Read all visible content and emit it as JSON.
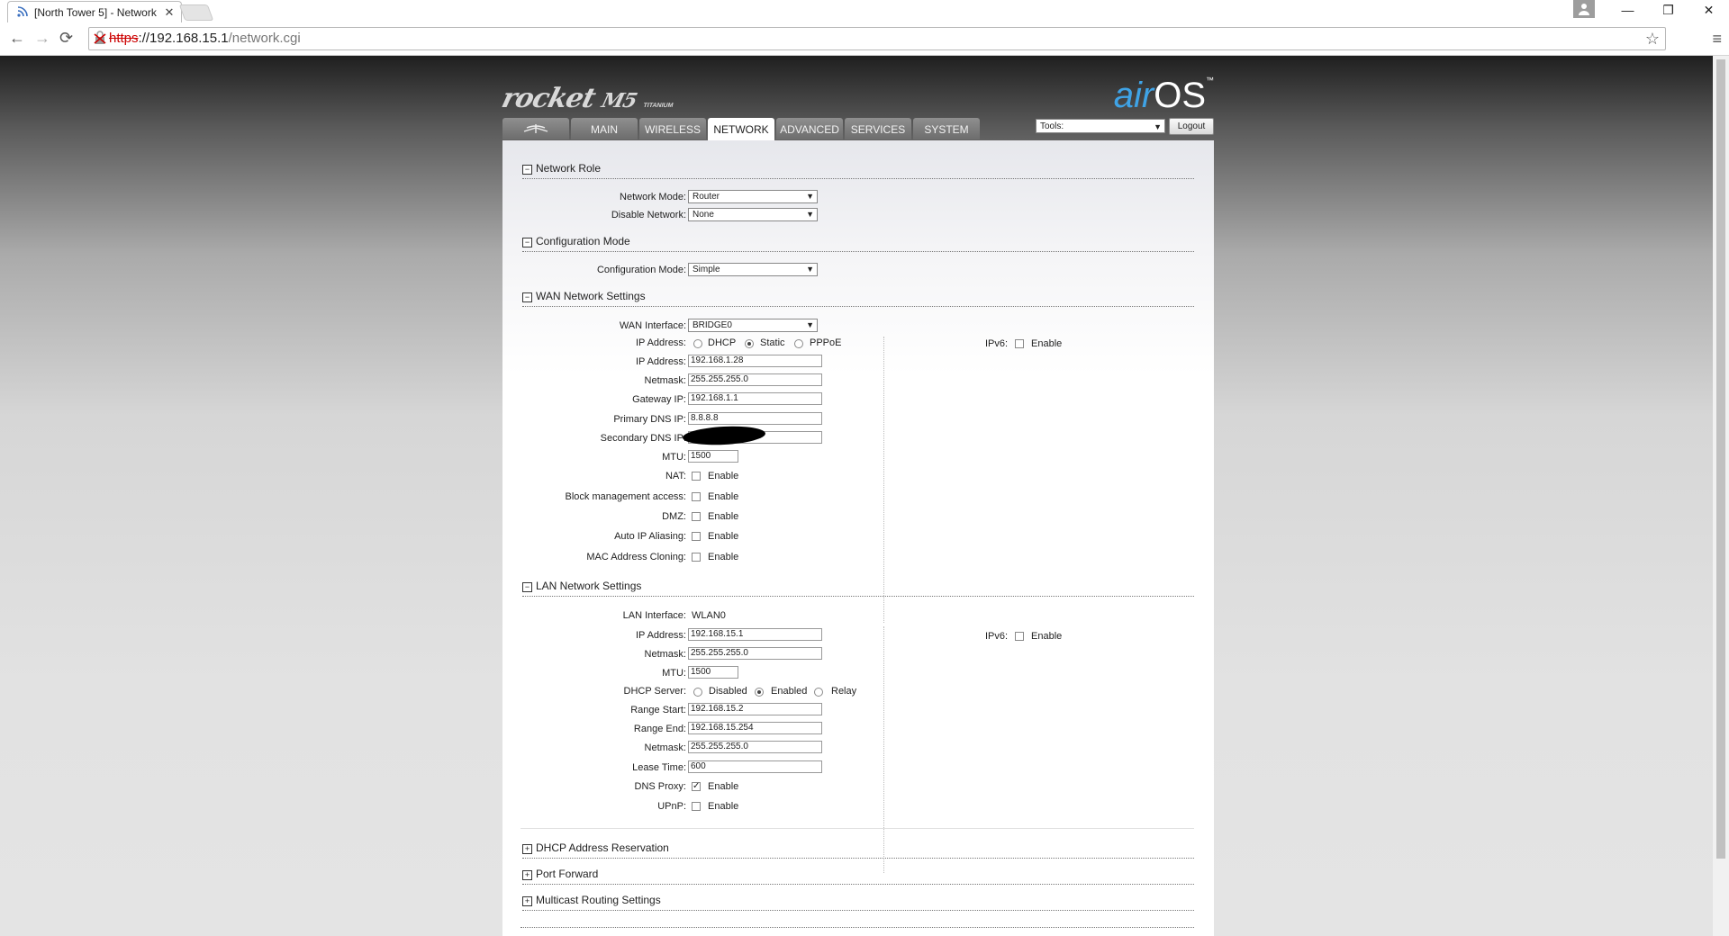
{
  "browser": {
    "tab_title": "[North Tower 5] - Network",
    "tab_icon": "rss-icon",
    "url_scheme": "https",
    "url_host": "://192.168.15.1",
    "url_path": "/network.cgi",
    "back_glyph": "←",
    "forward_glyph": "→",
    "reload_glyph": "⟳",
    "star_glyph": "☆",
    "menu_glyph": "≡",
    "close_glyph": "✕"
  },
  "window": {
    "minimize": "—",
    "restore": "❐",
    "close": "✕"
  },
  "brand": {
    "left_logo": "rocket",
    "left_model": "M5",
    "left_edition": "TITANIUM",
    "right_logo_air": "air",
    "right_logo_os": "OS",
    "right_logo_tm": "™"
  },
  "nav": {
    "tabs": [
      {
        "label": ""
      },
      {
        "label": "MAIN"
      },
      {
        "label": "WIRELESS"
      },
      {
        "label": "NETWORK"
      },
      {
        "label": "ADVANCED"
      },
      {
        "label": "SERVICES"
      },
      {
        "label": "SYSTEM"
      }
    ],
    "tools_label": "Tools:",
    "logout_label": "Logout"
  },
  "sections": {
    "network_role": {
      "title": "Network Role",
      "network_mode_label": "Network Mode:",
      "network_mode_value": "Router",
      "disable_network_label": "Disable Network:",
      "disable_network_value": "None"
    },
    "configuration_mode": {
      "title": "Configuration Mode",
      "label": "Configuration Mode:",
      "value": "Simple"
    },
    "wan": {
      "title": "WAN Network Settings",
      "interface_label": "WAN Interface:",
      "interface_value": "BRIDGE0",
      "ip_mode_label": "IP Address:",
      "ip_modes": [
        "DHCP",
        "Static",
        "PPPoE"
      ],
      "ip_mode_selected": "Static",
      "ip_label": "IP Address:",
      "ip_value": "192.168.1.28",
      "netmask_label": "Netmask:",
      "netmask_value": "255.255.255.0",
      "gateway_label": "Gateway IP:",
      "gateway_value": "192.168.1.1",
      "dns1_label": "Primary DNS IP:",
      "dns1_value": "8.8.8.8",
      "dns2_label": "Secondary DNS IP:",
      "dns2_value": "",
      "mtu_label": "MTU:",
      "mtu_value": "1500",
      "nat_label": "NAT:",
      "block_mgmt_label": "Block management access:",
      "dmz_label": "DMZ:",
      "auto_ip_label": "Auto IP Aliasing:",
      "mac_clone_label": "MAC Address Cloning:",
      "enable_text": "Enable",
      "ipv6_label": "IPv6:"
    },
    "lan": {
      "title": "LAN Network Settings",
      "interface_label": "LAN Interface:",
      "interface_value": "WLAN0",
      "ip_label": "IP Address:",
      "ip_value": "192.168.15.1",
      "netmask_label": "Netmask:",
      "netmask_value": "255.255.255.0",
      "mtu_label": "MTU:",
      "mtu_value": "1500",
      "dhcp_label": "DHCP Server:",
      "dhcp_modes": [
        "Disabled",
        "Enabled",
        "Relay"
      ],
      "dhcp_selected": "Enabled",
      "range_start_label": "Range Start:",
      "range_start_value": "192.168.15.2",
      "range_end_label": "Range End:",
      "range_end_value": "192.168.15.254",
      "dhcp_netmask_label": "Netmask:",
      "dhcp_netmask_value": "255.255.255.0",
      "lease_label": "Lease Time:",
      "lease_value": "600",
      "dns_proxy_label": "DNS Proxy:",
      "dns_proxy_checked": true,
      "upnp_label": "UPnP:",
      "enable_text": "Enable",
      "ipv6_label": "IPv6:"
    },
    "dhcp_reservation": {
      "title": "DHCP Address Reservation"
    },
    "port_forward": {
      "title": "Port Forward"
    },
    "multicast": {
      "title": "Multicast Routing Settings"
    }
  },
  "toggles": {
    "collapse": "−",
    "expand": "+",
    "check": "✓",
    "arrow": "▼"
  }
}
